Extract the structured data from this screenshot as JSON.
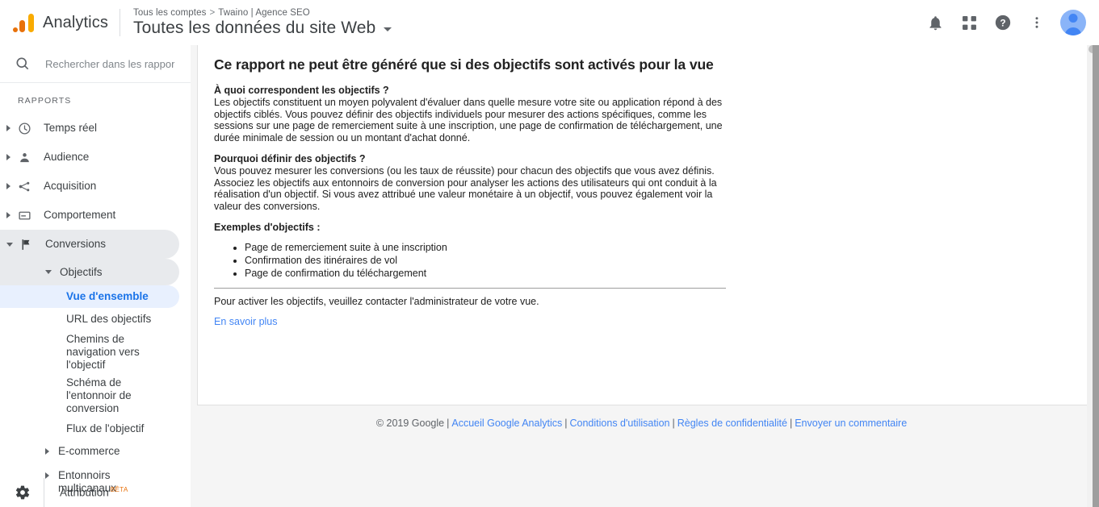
{
  "header": {
    "brand_name": "Analytics",
    "logo_icon": "google-analytics-logo",
    "breadcrumb": {
      "account": "Tous les comptes",
      "separator": ">",
      "property": "Twaino | Agence SEO"
    },
    "view_title": "Toutes les données du site Web",
    "icons": {
      "notifications": "bell-icon",
      "apps": "apps-grid-icon",
      "help": "help-circle-icon",
      "more": "more-vertical-icon",
      "account": "user-avatar"
    }
  },
  "sidebar": {
    "search": {
      "icon": "search-icon",
      "placeholder": "Rechercher dans les rapports",
      "value": ""
    },
    "section_label": "RAPPORTS",
    "items": [
      {
        "label": "Temps réel",
        "icon": "clock-icon",
        "expanded": false
      },
      {
        "label": "Audience",
        "icon": "person-icon",
        "expanded": false
      },
      {
        "label": "Acquisition",
        "icon": "share-nodes-icon",
        "expanded": false
      },
      {
        "label": "Comportement",
        "icon": "browser-card-icon",
        "expanded": false
      },
      {
        "label": "Conversions",
        "icon": "flag-icon",
        "expanded": true
      }
    ],
    "conversions_children": {
      "objectifs": {
        "label": "Objectifs",
        "expanded": true,
        "reports": [
          {
            "label": "Vue d'ensemble",
            "active": true
          },
          {
            "label": "URL des objectifs",
            "active": false
          },
          {
            "label": "Chemins de navigation vers l'objectif",
            "active": false
          },
          {
            "label": "Schéma de l'entonnoir de conversion",
            "active": false
          },
          {
            "label": "Flux de l'objectif",
            "active": false
          }
        ]
      },
      "groups": [
        {
          "label": "E-commerce",
          "expanded": false
        },
        {
          "label": "Entonnoirs multicanaux",
          "expanded": false
        }
      ]
    },
    "bottom": {
      "gear_icon": "gear-icon",
      "attribution_label": "Attribution",
      "beta_badge": "BÊTA"
    }
  },
  "main": {
    "heading": "Ce rapport ne peut être généré que si des objectifs sont activés pour la vue",
    "sections": [
      {
        "title": "À quoi correspondent les objectifs ?",
        "body": "Les objectifs constituent un moyen polyvalent d'évaluer dans quelle mesure votre site ou application répond à des objectifs ciblés. Vous pouvez définir des objectifs individuels pour mesurer des actions spécifiques, comme les sessions sur une page de remerciement suite à une inscription, une page de confirmation de téléchargement, une durée minimale de session ou un montant d'achat donné."
      },
      {
        "title": "Pourquoi définir des objectifs ?",
        "body": "Vous pouvez mesurer les conversions (ou les taux de réussite) pour chacun des objectifs que vous avez définis. Associez les objectifs aux entonnoirs de conversion pour analyser les actions des utilisateurs qui ont conduit à la réalisation d'un objectif. Si vous avez attribué une valeur monétaire à un objectif, vous pouvez également voir la valeur des conversions."
      }
    ],
    "examples_title": "Exemples d'objectifs :",
    "examples": [
      "Page de remerciement suite à une inscription",
      "Confirmation des itinéraires de vol",
      "Page de confirmation du téléchargement"
    ],
    "admin_note": "Pour activer les objectifs, veuillez contacter l'administrateur de votre vue.",
    "learn_more": "En savoir plus"
  },
  "footer": {
    "copyright": "© 2019 Google",
    "links": [
      "Accueil Google Analytics",
      "Conditions d'utilisation",
      "Règles de confidentialité",
      "Envoyer un commentaire"
    ],
    "separator": "|"
  },
  "colors": {
    "accent_blue": "#1a73e8",
    "link_blue": "#4285f4",
    "active_bg": "#e8f0fe",
    "selected_bg": "#e8eaed",
    "logo_amber": "#F9AB00",
    "logo_orange": "#E8710A",
    "page_bg": "#f5f5f5"
  }
}
